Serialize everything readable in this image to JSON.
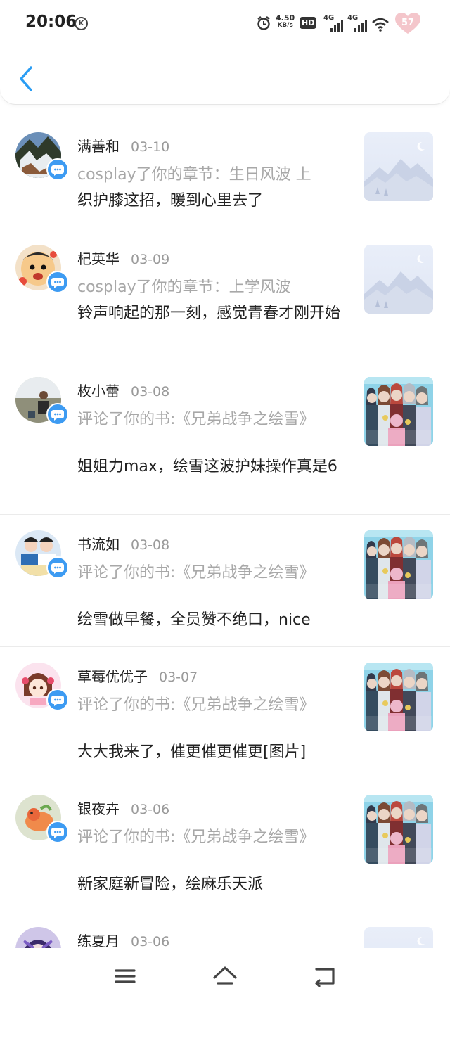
{
  "status_bar": {
    "time": "20:06",
    "k_badge": "K",
    "speed_value": "4.50",
    "speed_unit": "KB/s",
    "hd_label": "HD",
    "sim1_label": "4G",
    "sim2_label": "4G",
    "battery_level": "57",
    "icons": [
      "alarm-icon",
      "hd-icon",
      "signal-icon",
      "signal-icon",
      "wifi-icon",
      "battery-heart-icon"
    ]
  },
  "header": {
    "back_icon": "chevron-left-icon"
  },
  "colors": {
    "accent": "#3d9bf2",
    "muted_text": "#a8a8a8",
    "body_text": "#222222"
  },
  "notifications": [
    {
      "name": "满善和",
      "date": "03-10",
      "action": "cosplay了你的章节：生日风波 上",
      "comment": "织护膝这招，暖到心里去了",
      "thumb": "placeholder-image-icon"
    },
    {
      "name": "杞英华",
      "date": "03-09",
      "action": "cosplay了你的章节：上学风波",
      "comment": "铃声响起的那一刻，感觉青春才刚开始",
      "thumb": "placeholder-image-icon"
    },
    {
      "name": "枚小蕾",
      "date": "03-08",
      "action": "评论了你的书:《兄弟战争之绘雪》",
      "comment": "姐姐力max，绘雪这波护妹操作真是6",
      "thumb": "book-cover-image"
    },
    {
      "name": "书流如",
      "date": "03-08",
      "action": "评论了你的书:《兄弟战争之绘雪》",
      "comment": "绘雪做早餐，全员赞不绝口，nice",
      "thumb": "book-cover-image"
    },
    {
      "name": "草莓优优子",
      "date": "03-07",
      "action": "评论了你的书:《兄弟战争之绘雪》",
      "comment": "大大我来了，催更催更催更[图片]",
      "thumb": "book-cover-image"
    },
    {
      "name": "银夜卉",
      "date": "03-06",
      "action": "评论了你的书:《兄弟战争之绘雪》",
      "comment": "新家庭新冒险，绘麻乐天派",
      "thumb": "book-cover-image"
    },
    {
      "name": "练夏月",
      "date": "03-06",
      "action": "",
      "comment": "",
      "thumb": "placeholder-image-icon"
    }
  ],
  "nav": {
    "menu_icon": "menu-icon",
    "home_icon": "home-icon",
    "back_icon": "back-icon"
  }
}
